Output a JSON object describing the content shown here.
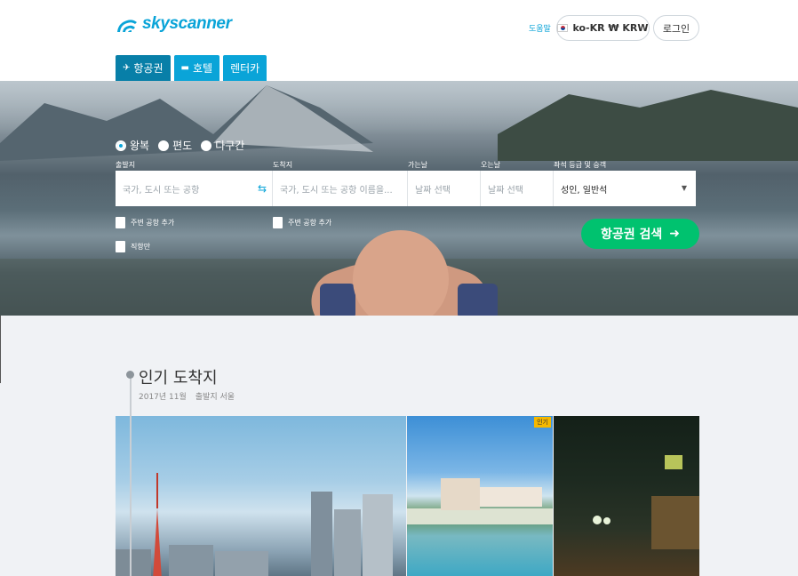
{
  "header": {
    "logo_text": "skyscanner",
    "help_label": "도움말",
    "locale_label": "ko-KR ₩ KRW",
    "login_label": "로그인"
  },
  "tabs": [
    {
      "label": "항공권",
      "icon": "plane-icon"
    },
    {
      "label": "호텔",
      "icon": "bed-icon"
    },
    {
      "label": "렌터카",
      "icon": ""
    }
  ],
  "search": {
    "trip_types": [
      "왕복",
      "편도",
      "다구간"
    ],
    "selected_trip_type": "왕복",
    "labels": {
      "origin": "출발지",
      "destination": "도착지",
      "depart": "가는날",
      "return": "오는날",
      "cabin": "좌석 등급 및 승객"
    },
    "origin_placeholder": "국가, 도시 또는 공항",
    "destination_placeholder": "국가, 도시 또는 공항 이름을...",
    "depart_placeholder": "날짜 선택",
    "return_placeholder": "날짜 선택",
    "cabin_value": "성인, 일반석",
    "nearby_origin_label": "주변 공항 추가",
    "nearby_dest_label": "주변 공항 추가",
    "direct_label": "직항만",
    "search_button_label": "항공권 검색"
  },
  "popular": {
    "title": "인기 도착지",
    "date": "2017년 11월",
    "origin": "출발지 서울",
    "badge": "인기"
  },
  "colors": {
    "brand": "#0aa4d8",
    "search_button": "#00c26f",
    "badge": "#f5b800"
  }
}
